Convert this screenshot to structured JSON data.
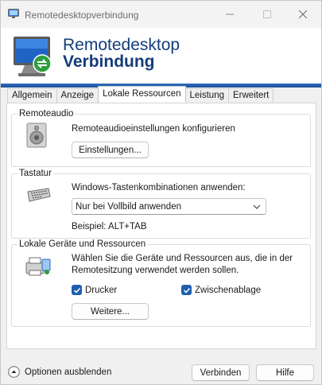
{
  "window": {
    "title": "Remotedesktopverbindung"
  },
  "banner": {
    "title_line1": "Remotedesktop",
    "title_line2": "Verbindung"
  },
  "tabs": [
    {
      "label": "Allgemein",
      "active": false
    },
    {
      "label": "Anzeige",
      "active": false
    },
    {
      "label": "Lokale Ressourcen",
      "active": true
    },
    {
      "label": "Leistung",
      "active": false
    },
    {
      "label": "Erweitert",
      "active": false
    }
  ],
  "remoteaudio": {
    "group_label": "Remoteaudio",
    "description": "Remoteaudioeinstellungen konfigurieren",
    "settings_button": "Einstellungen..."
  },
  "tastatur": {
    "group_label": "Tastatur",
    "description": "Windows-Tastenkombinationen anwenden:",
    "selected": "Nur bei Vollbild anwenden",
    "example": "Beispiel: ALT+TAB"
  },
  "devices": {
    "group_label": "Lokale Geräte und Ressourcen",
    "description_line1": "Wählen Sie die Geräte und Ressourcen aus, die in der",
    "description_line2": "Remotesitzung verwendet werden sollen.",
    "printer_label": "Drucker",
    "printer_checked": true,
    "clipboard_label": "Zwischenablage",
    "clipboard_checked": true,
    "more_button": "Weitere..."
  },
  "footer": {
    "options_label": "Optionen ausblenden",
    "connect_button": "Verbinden",
    "help_button": "Hilfe"
  },
  "colors": {
    "accent": "#1e5fae",
    "banner_text": "#143c7a"
  }
}
